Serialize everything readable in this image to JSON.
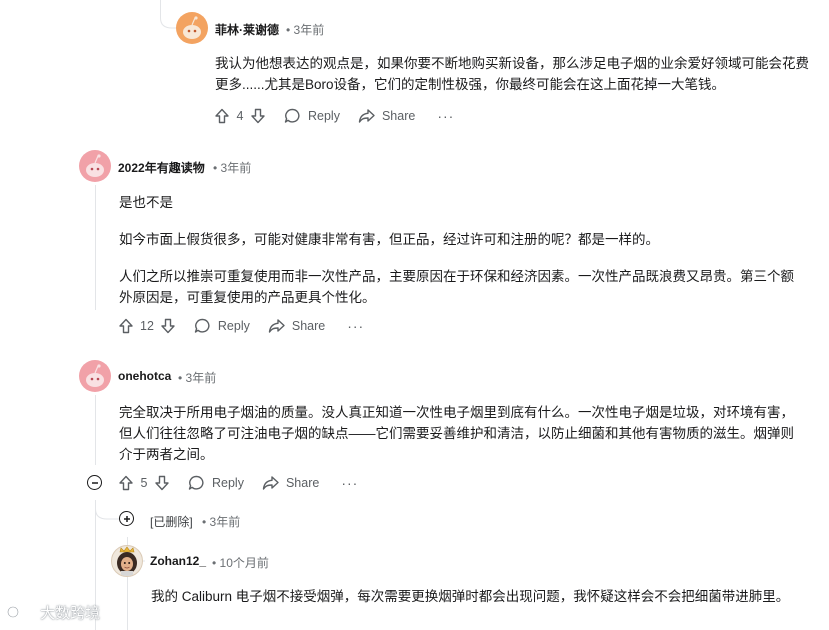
{
  "comments": [
    {
      "author": "菲林·莱谢德",
      "time": "3年前",
      "avatar_icon": "snoo-avatar-icon",
      "paragraphs": [
        "我认为他想表达的观点是，如果你要不断地购买新设备，那么涉足电子烟的业余爱好领域可能会花费更多......尤其是Boro设备，它们的定制性极强，你最终可能会在这上面花掉一大笔钱。"
      ],
      "score": "4",
      "reply_label": "Reply",
      "share_label": "Share"
    },
    {
      "author": "2022年有趣读物",
      "time": "3年前",
      "avatar_icon": "snoo-avatar-icon",
      "paragraphs": [
        "是也不是",
        "如今市面上假货很多，可能对健康非常有害，但正品，经过许可和注册的呢？都是一样的。",
        "人们之所以推崇可重复使用而非一次性产品，主要原因在于环保和经济因素。一次性产品既浪费又昂贵。第三个额外原因是，可重复使用的产品更具个性化。"
      ],
      "score": "12",
      "reply_label": "Reply",
      "share_label": "Share"
    },
    {
      "author": "onehotca",
      "time": "3年前",
      "avatar_icon": "snoo-avatar-icon",
      "paragraphs": [
        "完全取决于所用电子烟油的质量。没人真正知道一次性电子烟里到底有什么。一次性电子烟是垃圾，对环境有害，但人们往往忽略了可注油电子烟的缺点——它们需要妥善维护和清洁，以防止细菌和其他有害物质的滋生。烟弹则介于两者之间。"
      ],
      "score": "5",
      "reply_label": "Reply",
      "share_label": "Share"
    },
    {
      "author": "[已删除]",
      "time": "3年前"
    },
    {
      "author": "Zohan12_",
      "time": "10个月前",
      "avatar_icon": "user-photo-avatar",
      "paragraphs": [
        "我的 Caliburn 电子烟不接受烟弹，每次需要更换烟弹时都会出现问题，我怀疑这样会不会把细菌带进肺里。"
      ]
    }
  ],
  "more_label": "···",
  "separator": "•",
  "watermark": "大数跨境",
  "colors": {
    "thread_line": "#e3e5e8",
    "text": "#1a1a1b",
    "meta": "#6b6f73"
  }
}
